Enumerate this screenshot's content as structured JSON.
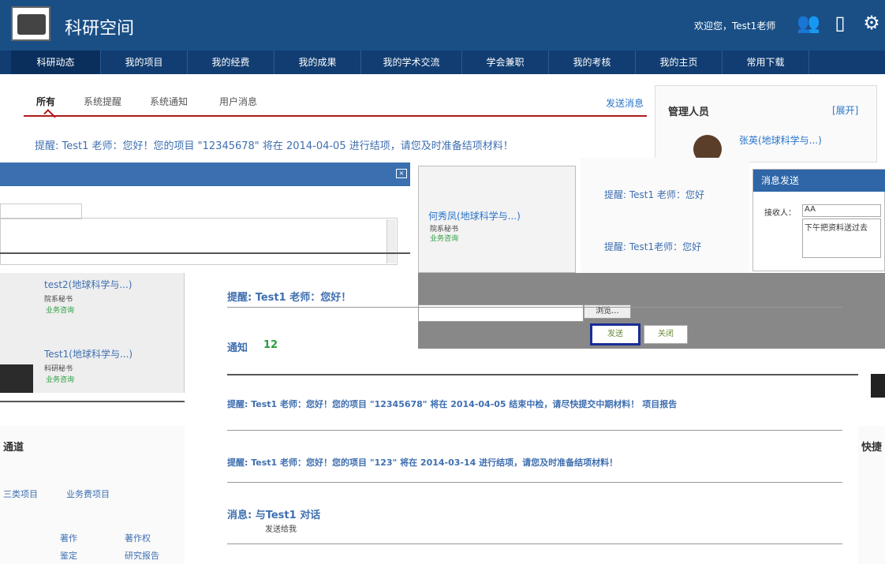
{
  "header": {
    "app_title": "科研空间",
    "welcome": "欢迎您，Test1老师"
  },
  "nav": {
    "items": [
      "科研动态",
      "我的项目",
      "我的经费",
      "我的成果",
      "我的学术交流",
      "学会兼职",
      "我的考核",
      "我的主页",
      "常用下载"
    ]
  },
  "subtabs": {
    "items": [
      "所有",
      "系统提醒",
      "系统通知",
      "用户消息"
    ],
    "send_link": "发送消息"
  },
  "notice1": "提醒: Test1 老师：您好！您的项目 \"12345678\" 将在 2014-04-05 进行结项，请您及时准备结项材料！",
  "admin": {
    "title": "管理人员",
    "toggle": "[展开]",
    "name": "张英(地球科学与...)"
  },
  "chat": {
    "contact": "何秀凤(地球科学与...)",
    "contact_role": "院系秘书",
    "contact_link": "业务咨询",
    "remind_a": "提醒: Test1 老师：您好",
    "remind_b": "提醒: Test1老师：您好"
  },
  "users": [
    {
      "name": "test2(地球科学与...)",
      "role": "院系秘书",
      "link": "业务咨询"
    },
    {
      "name": "Test1(地球科学与...)",
      "role": "科研秘书",
      "link": "业务咨询"
    }
  ],
  "send_dialog": {
    "title": "消息发送",
    "receiver_label": "接收人：",
    "receiver_value": "AA",
    "content": "下午把资料送过去"
  },
  "buttons": {
    "attach": "浏览...",
    "send": "发送",
    "close": "关闭"
  },
  "messages": {
    "m1": "提醒: Test1 老师：您好！",
    "reply_label": "通知",
    "reply_num": "12",
    "m2": "提醒: Test1 老师：您好！您的项目 \"12345678\" 将在 2014-04-05 结束中检，请尽快提交中期材料！ 项目报告",
    "m3": "提醒: Test1 老师：您好！您的项目 \"123\" 将在 2014-03-14 进行结项，请您及时准备结项材料！",
    "m4": "消息: 与Test1 对话",
    "m4_sub": "发送给我"
  },
  "left_quick": {
    "head": "通道",
    "items": [
      "三类项目",
      "业务费项目",
      "著作",
      "著作权",
      "鉴定",
      "研究报告"
    ]
  },
  "right_quick": {
    "head": "快捷"
  }
}
